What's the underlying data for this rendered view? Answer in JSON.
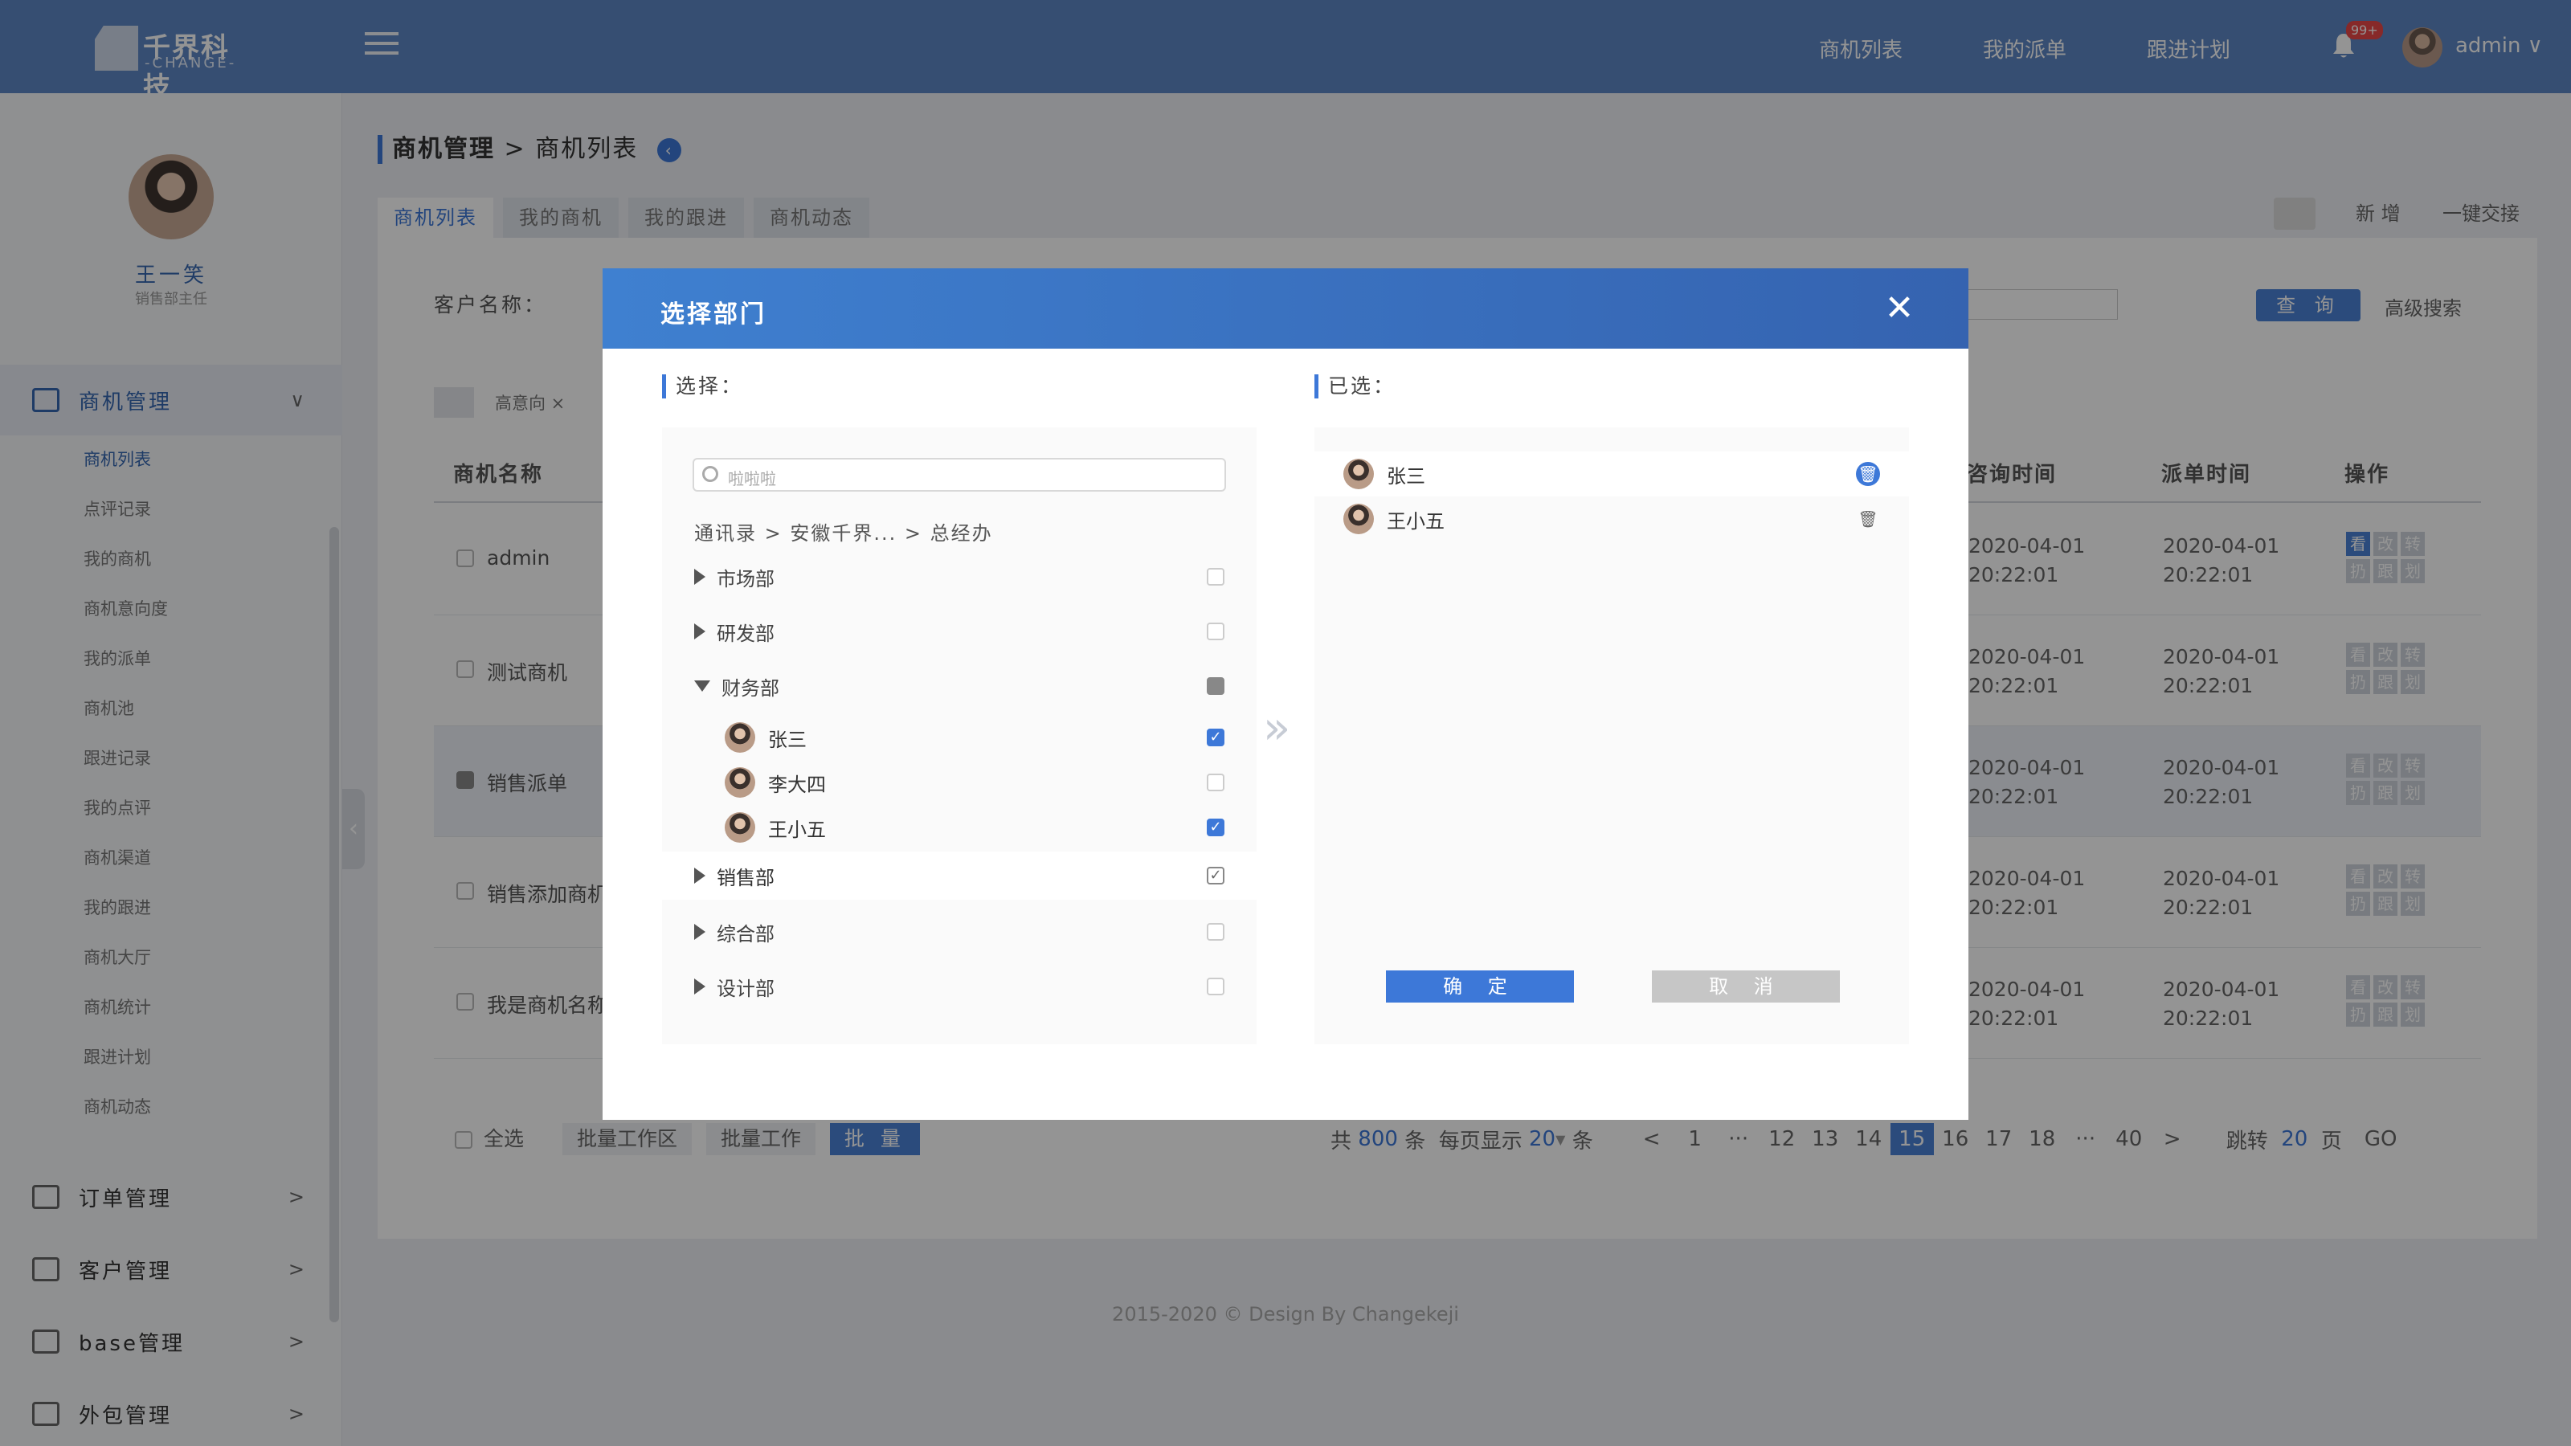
{
  "header": {
    "logo_main": "千界科技",
    "logo_sub": "-CHANGE-",
    "nav": [
      "商机列表",
      "我的派单",
      "跟进计划"
    ],
    "notif_badge": "99+",
    "user": "admin ∨"
  },
  "sidebar": {
    "profile_name": "王一笑",
    "profile_role": "销售部主任",
    "groups": [
      {
        "label": "商机管理",
        "icon": "briefcase-icon",
        "arrow": "∨"
      },
      {
        "label": "订单管理",
        "icon": "edit-icon",
        "arrow": ">"
      },
      {
        "label": "客户管理",
        "icon": "users-icon",
        "arrow": ">"
      },
      {
        "label": "base管理",
        "icon": "list-icon",
        "arrow": ">"
      },
      {
        "label": "外包管理",
        "icon": "briefcase-icon",
        "arrow": ">"
      }
    ],
    "sub_items": [
      "商机列表",
      "点评记录",
      "我的商机",
      "商机意向度",
      "我的派单",
      "商机池",
      "跟进记录",
      "我的点评",
      "商机渠道",
      "我的跟进",
      "商机大厅",
      "商机统计",
      "跟进计划",
      "商机动态"
    ]
  },
  "main": {
    "breadcrumb_root": "商机管理",
    "breadcrumb_sep": ">",
    "breadcrumb_leaf": "商机列表",
    "tabs": [
      "商机列表",
      "我的商机",
      "我的跟进",
      "商机动态"
    ],
    "tools": {
      "add": "新 增",
      "handover": "一键交接"
    },
    "filter_label": "客户名称：",
    "query_btn": "查 询",
    "adv_search": "高级搜索",
    "tag": "高意向 ×",
    "columns": {
      "name": "商机名称",
      "consult_time": "咨询时间",
      "dispatch_time": "派单时间",
      "ops": "操作"
    },
    "rows": [
      {
        "name": "admin",
        "t1a": "2020-04-01",
        "t1b": "20:22:01",
        "t2a": "2020-04-01",
        "t2b": "20:22:01"
      },
      {
        "name": "测试商机",
        "t1a": "2020-04-01",
        "t1b": "20:22:01",
        "t2a": "2020-04-01",
        "t2b": "20:22:01"
      },
      {
        "name": "销售派单",
        "t1a": "2020-04-01",
        "t1b": "20:22:01",
        "t2a": "2020-04-01",
        "t2b": "20:22:01"
      },
      {
        "name": "销售添加商机",
        "t1a": "2020-04-01",
        "t1b": "20:22:01",
        "t2a": "2020-04-01",
        "t2b": "20:22:01"
      },
      {
        "name": "我是商机名称",
        "t1a": "2020-04-01",
        "t1b": "20:22:01",
        "t2a": "2020-04-01",
        "t2b": "20:22:01"
      }
    ],
    "ops_labels": [
      "看",
      "改",
      "转",
      "扔",
      "跟",
      "划"
    ],
    "bottom": {
      "select_all": "全选",
      "b1": "批量工作区",
      "b2": "批量工作",
      "b3": "批 量"
    },
    "pager": {
      "total_pre": "共",
      "total": "800",
      "total_post": "条",
      "per_page_pre": "每页显示",
      "per_page": "20",
      "per_page_post": "条",
      "prev": "<",
      "next": ">",
      "ellipsis": "···",
      "pages": [
        "1",
        "12",
        "13",
        "14",
        "15",
        "16",
        "17",
        "18",
        "40"
      ],
      "current": "15",
      "jump_pre": "跳转",
      "jump_val": "20",
      "jump_post": "页",
      "go": "GO"
    }
  },
  "footer": "2015-2020 © Design By Changekeji",
  "modal": {
    "title": "选择部门",
    "close": "✕",
    "left_label": "选择：",
    "right_label": "已选：",
    "search_placeholder": "啦啦啦",
    "path": "通讯录 > 安徽千界... > 总经办",
    "departments": [
      {
        "name": "市场部",
        "expanded": false,
        "state": "empty"
      },
      {
        "name": "研发部",
        "expanded": false,
        "state": "empty"
      },
      {
        "name": "财务部",
        "expanded": true,
        "state": "partial"
      },
      {
        "name": "销售部",
        "expanded": false,
        "state": "checked"
      },
      {
        "name": "综合部",
        "expanded": false,
        "state": "empty"
      },
      {
        "name": "设计部",
        "expanded": false,
        "state": "empty"
      }
    ],
    "people": [
      {
        "name": "张三",
        "checked": true
      },
      {
        "name": "李大四",
        "checked": false
      },
      {
        "name": "王小五",
        "checked": true
      }
    ],
    "selected": [
      "张三",
      "王小五"
    ],
    "ok": "确 定",
    "cancel": "取 消"
  },
  "colors": {
    "primary": "#3d78d8",
    "header": "#5e87c4",
    "overlay": "rgba(0,0,0,0.42)"
  }
}
